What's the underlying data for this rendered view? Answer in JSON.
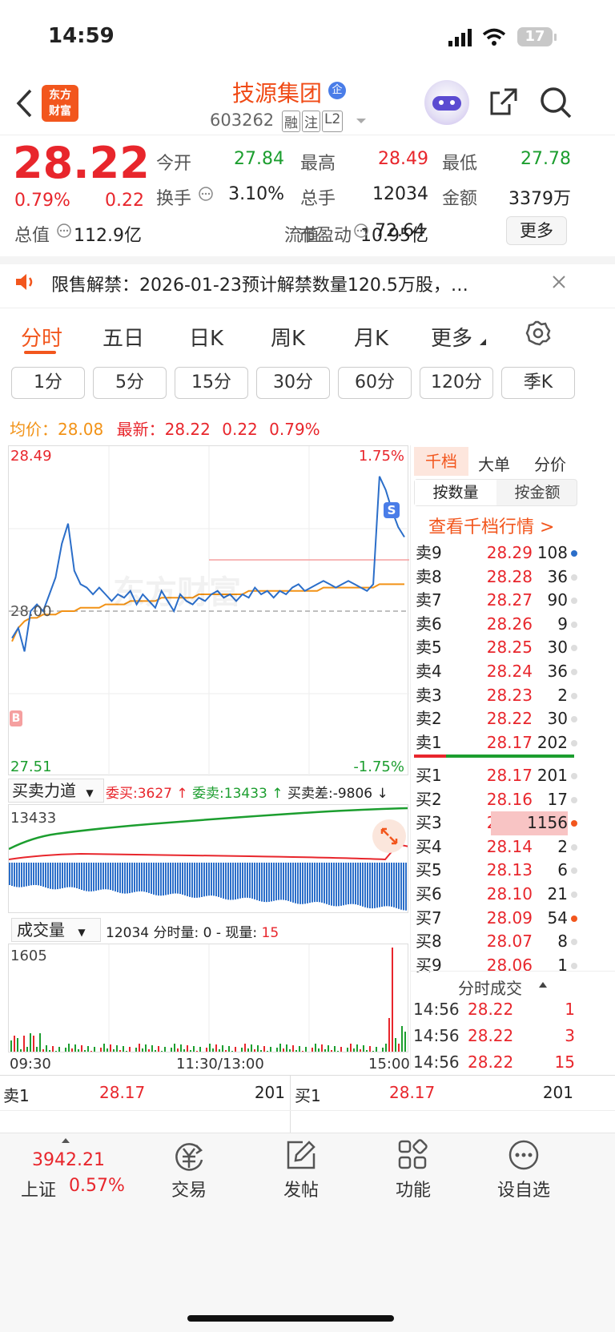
{
  "status": {
    "time": "14:59",
    "battery": "17"
  },
  "header": {
    "logo_line1": "东方",
    "logo_line2": "财富",
    "name": "技源集团",
    "badge": "企",
    "code": "603262",
    "tags": [
      "融",
      "注",
      "L2"
    ]
  },
  "quote": {
    "price": "28.22",
    "pct": "0.79%",
    "chg": "0.22",
    "rows": [
      [
        {
          "label": "今开",
          "value": "27.84",
          "cls": "green"
        },
        {
          "label": "最高",
          "value": "28.49",
          "cls": "red"
        },
        {
          "label": "最低",
          "value": "27.78",
          "cls": "green"
        }
      ],
      [
        {
          "label": "换手",
          "value": "3.10%",
          "cls": ""
        },
        {
          "label": "总手",
          "value": "12034",
          "cls": ""
        },
        {
          "label": "金额",
          "value": "3379万",
          "cls": ""
        }
      ],
      [
        {
          "label": "总值",
          "value": "112.9亿",
          "cls": ""
        },
        {
          "label": "流值",
          "value": "10.95亿",
          "cls": ""
        },
        {
          "label": "市盈动",
          "value": "72.64",
          "cls": ""
        }
      ]
    ],
    "more": "更多"
  },
  "notice": "限售解禁：2026-01-23预计解禁数量120.5万股，…",
  "period_tabs": [
    "分时",
    "五日",
    "日K",
    "周K",
    "月K",
    "更多"
  ],
  "minute_tabs": [
    "1分",
    "5分",
    "15分",
    "30分",
    "60分",
    "120分",
    "季K"
  ],
  "info_bar": {
    "avg_label": "均价：",
    "avg": "28.08",
    "last_label": "最新：",
    "last": "28.22",
    "chg": "0.22",
    "pct": "0.79%"
  },
  "chart": {
    "y_top": "28.49",
    "y_mid": "28.00",
    "y_bot": "27.51",
    "pct_top": "1.75%",
    "pct_bot": "-1.75%",
    "watermark": "东方财富",
    "marker_s": "S",
    "marker_b": "B"
  },
  "chart_data": {
    "type": "line",
    "x_start": "09:30",
    "x_mid": "11:30/13:00",
    "x_end": "15:00",
    "ylim": [
      27.51,
      28.49
    ],
    "series": [
      {
        "values": [
          27.92,
          27.95,
          27.88,
          28.0,
          28.02,
          28.0,
          28.05,
          28.1,
          28.2,
          28.26,
          28.12,
          28.08,
          28.07,
          28.05,
          28.07,
          28.05,
          28.03,
          28.05,
          28.04,
          28.06,
          28.02,
          28.05,
          28.03,
          28.01,
          28.06,
          28.03,
          28.0,
          28.05,
          28.03,
          28.02,
          28.04,
          28.03,
          28.05,
          28.06,
          28.04,
          28.05,
          28.03,
          28.05,
          28.04,
          28.07,
          28.05,
          28.06,
          28.04,
          28.06,
          28.05,
          28.07,
          28.08,
          28.06,
          28.07,
          28.08,
          28.09,
          28.08,
          28.07,
          28.08,
          28.09,
          28.08,
          28.07,
          28.06,
          28.08,
          28.4,
          28.36,
          28.3,
          28.25,
          28.22
        ]
      },
      {
        "values": [
          27.91,
          27.95,
          27.97,
          27.98,
          27.98,
          27.99,
          27.99,
          27.99,
          28.0,
          28.0,
          28.0,
          28.01,
          28.01,
          28.01,
          28.01,
          28.02,
          28.02,
          28.02,
          28.02,
          28.03,
          28.03,
          28.03,
          28.03,
          28.03,
          28.04,
          28.04,
          28.04,
          28.04,
          28.04,
          28.04,
          28.05,
          28.05,
          28.05,
          28.05,
          28.05,
          28.05,
          28.05,
          28.05,
          28.06,
          28.06,
          28.06,
          28.06,
          28.06,
          28.06,
          28.06,
          28.06,
          28.06,
          28.06,
          28.06,
          28.06,
          28.07,
          28.07,
          28.07,
          28.07,
          28.07,
          28.07,
          28.07,
          28.07,
          28.07,
          28.08,
          28.08,
          28.08,
          28.08,
          28.08
        ]
      }
    ]
  },
  "force": {
    "title": "买卖力道",
    "buy_label": "委买:",
    "buy": "3627",
    "sell_label": "委卖:",
    "sell": "13433",
    "diff_label": "买卖差:",
    "diff": "-9806",
    "y_top": "13433",
    "y_bot": "-11775"
  },
  "volume": {
    "title": "成交量",
    "info": "12034 分时量: 0 - 现量:",
    "now": "15",
    "y_top": "1605"
  },
  "book_tabs": [
    "千档",
    "大单",
    "分价"
  ],
  "book_sub": [
    "按数量",
    "按金额"
  ],
  "book_link": "查看千档行情 >",
  "asks": [
    {
      "label": "卖9",
      "price": "28.29",
      "vol": "108"
    },
    {
      "label": "卖8",
      "price": "28.28",
      "vol": "36"
    },
    {
      "label": "卖7",
      "price": "28.27",
      "vol": "90"
    },
    {
      "label": "卖6",
      "price": "28.26",
      "vol": "9"
    },
    {
      "label": "卖5",
      "price": "28.25",
      "vol": "30"
    },
    {
      "label": "卖4",
      "price": "28.24",
      "vol": "36"
    },
    {
      "label": "卖3",
      "price": "28.23",
      "vol": "2"
    },
    {
      "label": "卖2",
      "price": "28.22",
      "vol": "30"
    },
    {
      "label": "卖1",
      "price": "28.17",
      "vol": "202"
    }
  ],
  "bids": [
    {
      "label": "买1",
      "price": "28.17",
      "vol": "201"
    },
    {
      "label": "买2",
      "price": "28.16",
      "vol": "17"
    },
    {
      "label": "买3",
      "price": "28.15",
      "vol": "1156"
    },
    {
      "label": "买4",
      "price": "28.14",
      "vol": "2"
    },
    {
      "label": "买5",
      "price": "28.13",
      "vol": "6"
    },
    {
      "label": "买6",
      "price": "28.10",
      "vol": "21"
    },
    {
      "label": "买7",
      "price": "28.09",
      "vol": "54"
    },
    {
      "label": "买8",
      "price": "28.07",
      "vol": "8"
    },
    {
      "label": "买9",
      "price": "28.06",
      "vol": "1"
    }
  ],
  "trades_title": "分时成交",
  "trades": [
    {
      "time": "14:56",
      "price": "28.22",
      "vol": "1"
    },
    {
      "time": "14:56",
      "price": "28.22",
      "vol": "3"
    },
    {
      "time": "14:56",
      "price": "28.22",
      "vol": "15"
    }
  ],
  "bottom_quote": {
    "sell_label": "卖1",
    "sell_price": "28.17",
    "sell_vol": "201",
    "buy_label": "买1",
    "buy_price": "28.17",
    "buy_vol": "201"
  },
  "tabbar": {
    "index_value": "3942.21",
    "index_name": "上证",
    "index_pct": "0.57%",
    "items": [
      "交易",
      "发帖",
      "功能",
      "设自选"
    ]
  },
  "colors": {
    "red": "#e8262c",
    "green": "#1c9e2f",
    "orange": "#f29216",
    "blue": "#2b6ec9"
  }
}
